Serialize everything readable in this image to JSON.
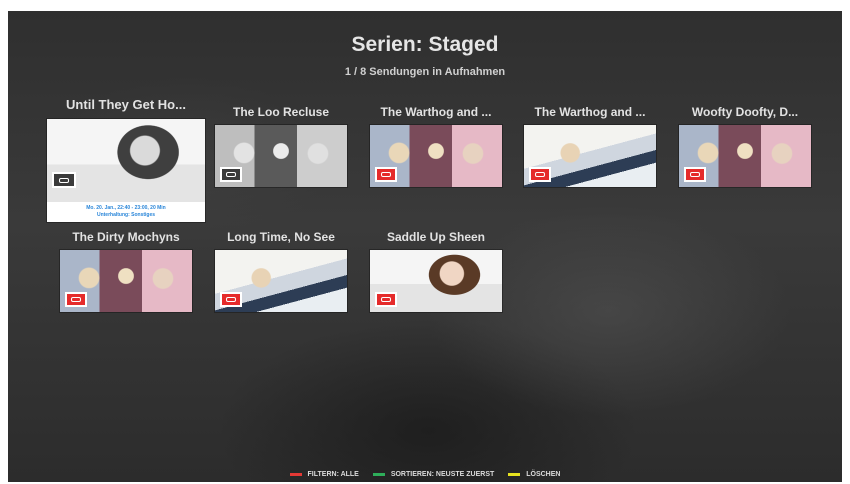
{
  "header": {
    "title": "Serien: Staged",
    "subtitle": "1 / 8 Sendungen in Aufnahmen"
  },
  "colors": {
    "badge_red": "#e52b2b",
    "info_text_blue": "#2a86d9",
    "footer_red": "#e53935",
    "footer_green": "#2eae5a",
    "footer_yellow": "#e6e21f"
  },
  "recordings": [
    {
      "title": "Until They Get Ho...",
      "art": "girl-gray",
      "badge": "record-icon",
      "selected": true,
      "info_line1": "Mo. 20. Jan., 22:40 - 23:00, 20 Min",
      "info_line2": "Unterhaltung: Sonstiges"
    },
    {
      "title": "The Loo Recluse",
      "art": "trio-gray",
      "badge": "record-icon"
    },
    {
      "title": "The Warthog and ...",
      "art": "trio",
      "badge": "record-icon"
    },
    {
      "title": "The Warthog and ...",
      "art": "bed",
      "badge": "record-icon"
    },
    {
      "title": "Woofty Doofty, D...",
      "art": "trio",
      "badge": "record-icon"
    },
    {
      "title": "The Dirty Mochyns",
      "art": "trio",
      "badge": "record-icon"
    },
    {
      "title": "Long Time, No See",
      "art": "bed",
      "badge": "record-icon"
    },
    {
      "title": "Saddle Up Sheen",
      "art": "girl",
      "badge": "record-icon"
    }
  ],
  "footer": {
    "filter_label": "FILTERN: ALLE",
    "sort_label": "SORTIEREN: NEUSTE ZUERST",
    "delete_label": "LÖSCHEN"
  }
}
